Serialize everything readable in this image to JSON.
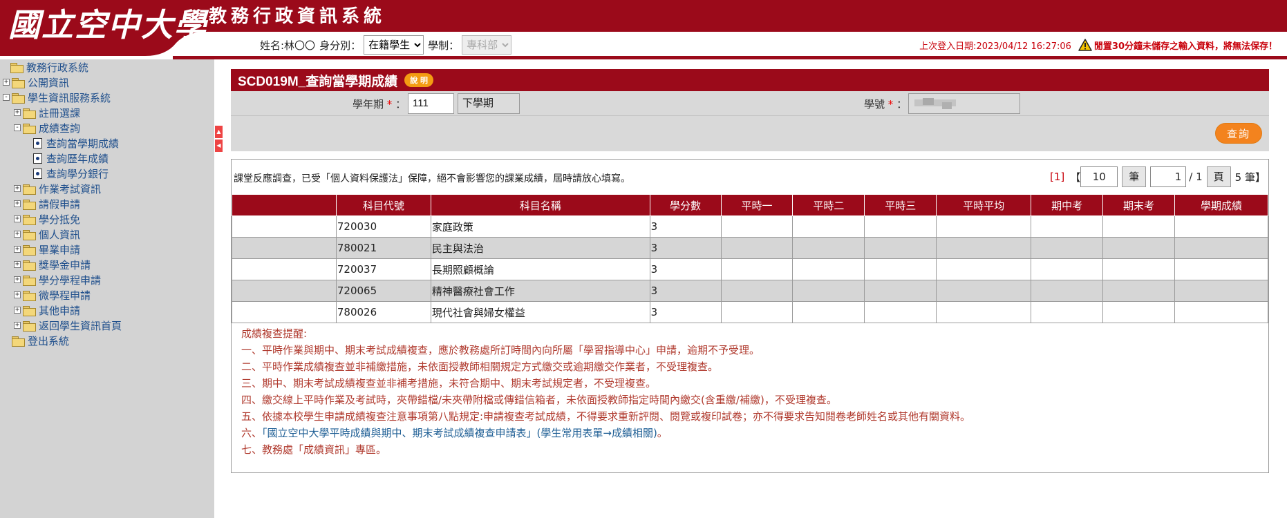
{
  "header": {
    "logo_text": "國立空中大學",
    "system_title": "教務行政資訊系統",
    "name_label": "姓名:林〇〇",
    "status_label": "身分別：",
    "status_value": "在籍學生",
    "program_label": "學制：",
    "program_value": "專科部",
    "last_login": "上次登入日期:2023/04/12 16:27:06",
    "idle_warning": "閒置30分鐘未儲存之輸入資料，將無法保存！",
    "colors": {
      "brand": "#9b0a1a",
      "warning": "#c8000a"
    }
  },
  "sidebar": {
    "root": "教務行政系統",
    "items": [
      {
        "label": "公開資訊",
        "toggle": "+"
      },
      {
        "label": "學生資訊服務系統",
        "toggle": "-"
      },
      {
        "label": "註冊選課",
        "toggle": "+"
      },
      {
        "label": "成績查詢",
        "toggle": "-"
      },
      {
        "label": "查詢當學期成績"
      },
      {
        "label": "查詢歷年成績"
      },
      {
        "label": "查詢學分銀行"
      },
      {
        "label": "作業考試資訊",
        "toggle": "+"
      },
      {
        "label": "請假申請",
        "toggle": "+"
      },
      {
        "label": "學分抵免",
        "toggle": "+"
      },
      {
        "label": "個人資訊",
        "toggle": "+"
      },
      {
        "label": "畢業申請",
        "toggle": "+"
      },
      {
        "label": "獎學金申請",
        "toggle": "+"
      },
      {
        "label": "學分學程申請",
        "toggle": "+"
      },
      {
        "label": "微學程申請",
        "toggle": "+"
      },
      {
        "label": "其他申請",
        "toggle": "+"
      },
      {
        "label": "返回學生資訊首頁",
        "toggle": "+"
      },
      {
        "label": "登出系統"
      }
    ],
    "handle_up": "▲",
    "handle_down": "◀"
  },
  "main": {
    "title": "SCD019M_查詢當學期成績",
    "help_label": "說 明",
    "filter": {
      "year_label": "學年期",
      "year_value": "111",
      "term_value": "下學期",
      "student_id_label": "學號",
      "required_mark": "*",
      "colon": "："
    },
    "query_label": "查詢",
    "notice": "課堂反應調查，已受「個人資料保護法」保障，絕不會影響您的課業成績，屆時請放心填寫。",
    "pager": {
      "current_marker": "[1]",
      "open_bracket": "【",
      "page_size": "10",
      "unit_label": "筆",
      "page_value": "1",
      "page_total": "/ 1",
      "page_unit": "頁",
      "total": "5 筆",
      "close_bracket": "】"
    },
    "table": {
      "columns": [
        "",
        "科目代號",
        "科目名稱",
        "學分數",
        "平時一",
        "平時二",
        "平時三",
        "平時平均",
        "期中考",
        "期末考",
        "學期成績"
      ],
      "rows": [
        {
          "code": "720030",
          "name": "家庭政策",
          "credits": "3"
        },
        {
          "code": "780021",
          "name": "民主與法治",
          "credits": "3"
        },
        {
          "code": "720037",
          "name": "長期照顧概論",
          "credits": "3"
        },
        {
          "code": "720065",
          "name": "精神醫療社會工作",
          "credits": "3"
        },
        {
          "code": "780026",
          "name": "現代社會與婦女權益",
          "credits": "3"
        }
      ]
    },
    "reminders": {
      "title": "成績複查提醒:",
      "lines": [
        "一、平時作業與期中、期末考試成績複查，應於教務處所訂時間內向所屬「學習指導中心」申請，逾期不予受理。",
        "二、平時作業成績複查並非補繳措施，未依面授教師相關規定方式繳交或逾期繳交作業者，不受理複查。",
        "三、期中、期末考試成績複查並非補考措施，未符合期中、期末考試規定者，不受理複查。",
        "四、繳交線上平時作業及考試時，夾帶錯檔/未夾帶附檔或傳錯信箱者，未依面授教師指定時間內繳交(含重繳/補繳)，不受理複查。",
        "五、依據本校學生申請成績複查注意事項第八點規定:申請複查考試成績，不得要求重新評閱、閱覽或複印試卷；亦不得要求告知閱卷老師姓名或其他有關資料。"
      ],
      "line6_prefix": "六、",
      "line6_link": "「國立空中大學平時成績與期中、期末考試成績複查申請表」(學生常用表單→成績相關)",
      "line6_suffix": "。",
      "line7_prefix": "七、",
      "line7_link": "教務處「成績資訊」專區",
      "line7_suffix": "。"
    }
  }
}
